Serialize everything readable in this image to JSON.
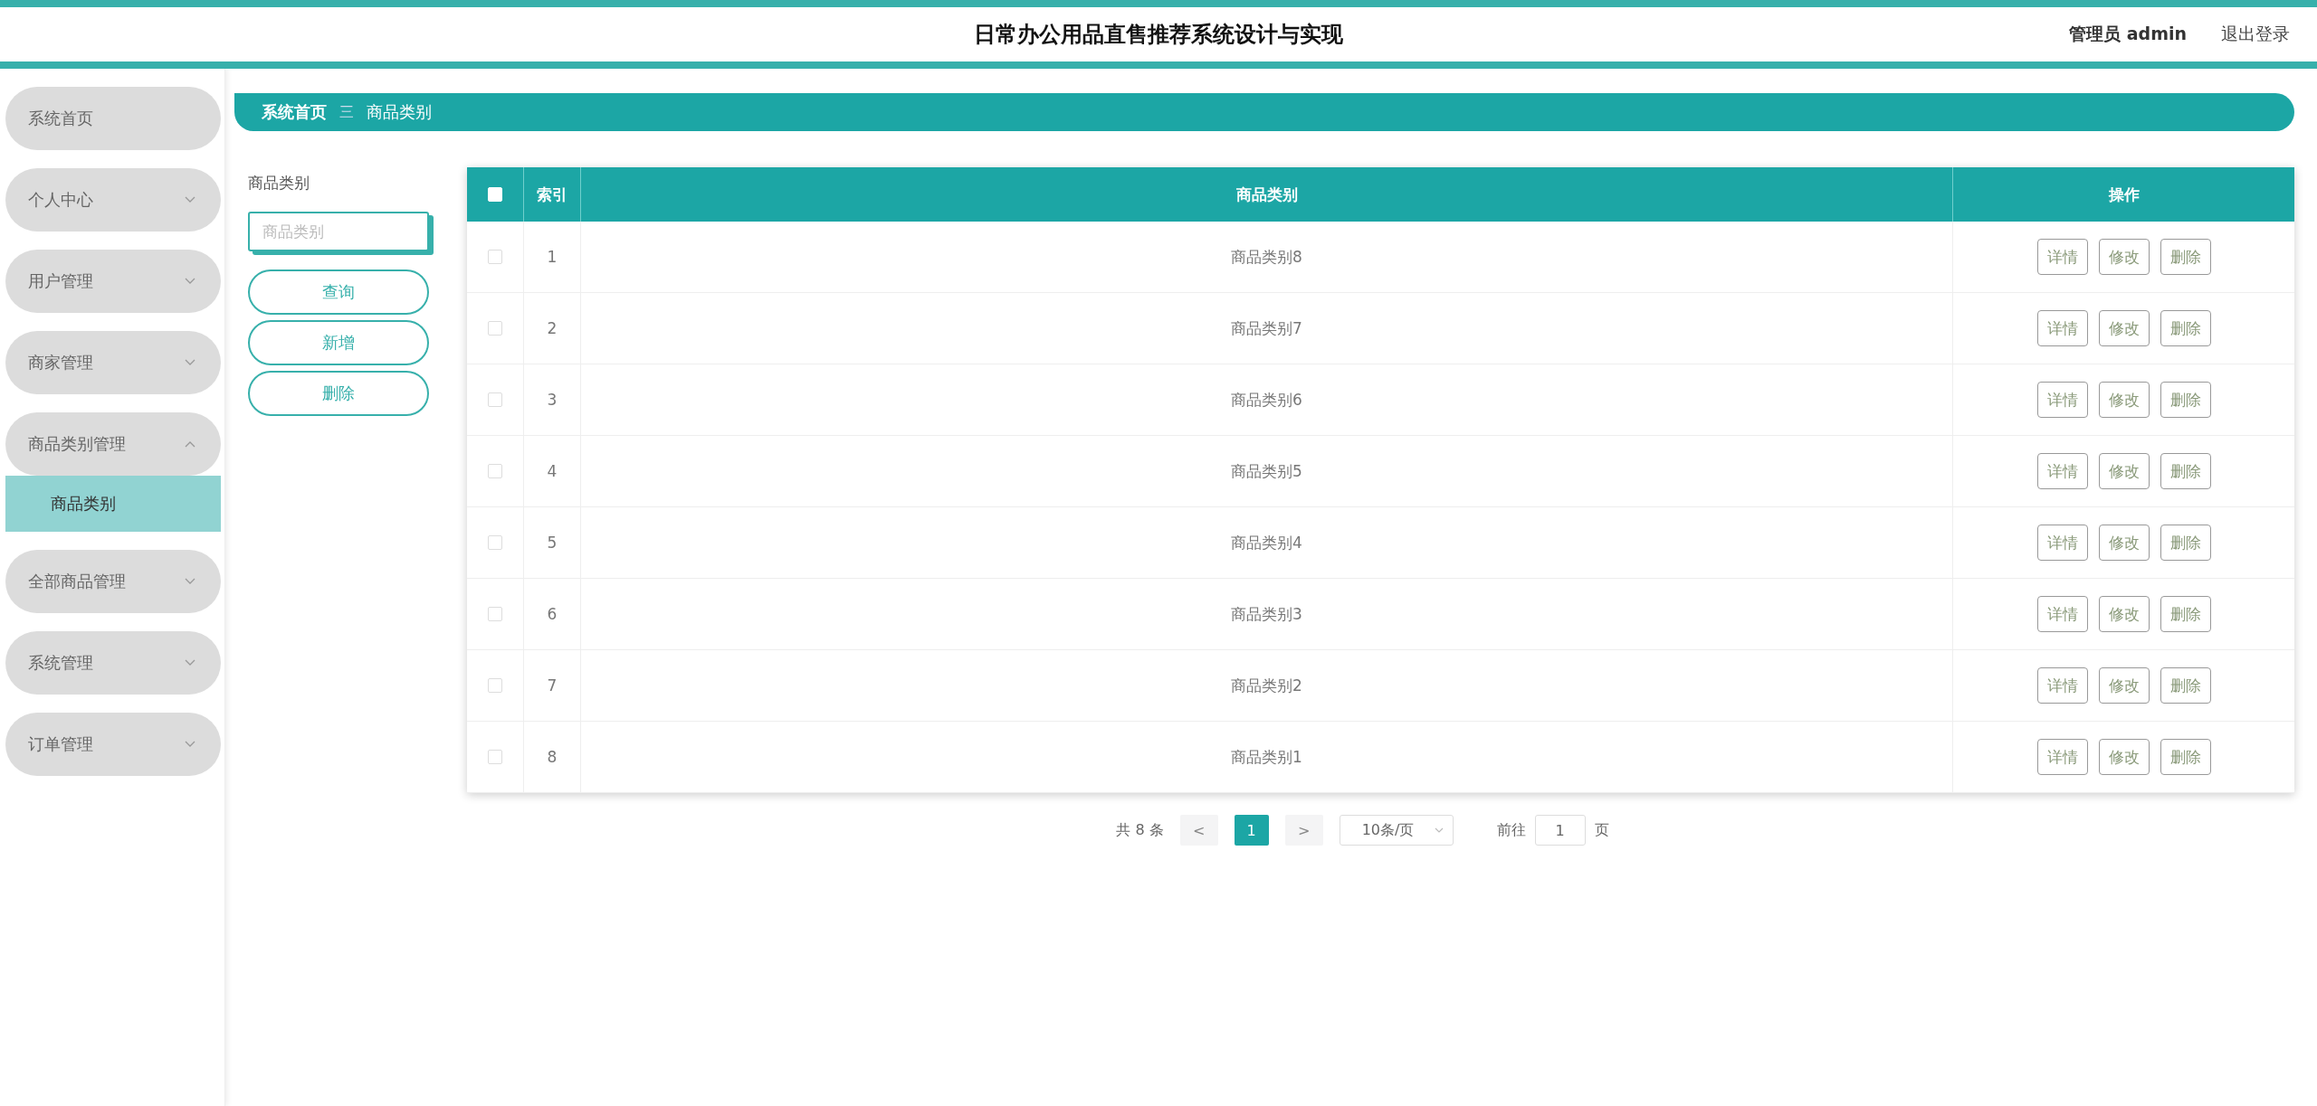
{
  "header": {
    "title": "日常办公用品直售推荐系统设计与实现",
    "user": "管理员 admin",
    "logout": "退出登录"
  },
  "sidebar": {
    "items": [
      {
        "label": "系统首页",
        "kind": "link",
        "selected": false
      },
      {
        "label": "个人中心",
        "kind": "menu",
        "expanded": false
      },
      {
        "label": "用户管理",
        "kind": "menu",
        "expanded": false
      },
      {
        "label": "商家管理",
        "kind": "menu",
        "expanded": false
      },
      {
        "label": "商品类别管理",
        "kind": "menu",
        "expanded": true,
        "children": [
          {
            "label": "商品类别",
            "selected": true
          }
        ]
      },
      {
        "label": "全部商品管理",
        "kind": "menu",
        "expanded": false
      },
      {
        "label": "系统管理",
        "kind": "menu",
        "expanded": false
      },
      {
        "label": "订单管理",
        "kind": "menu",
        "expanded": false
      }
    ]
  },
  "breadcrumb": {
    "items": [
      "系统首页",
      "商品类别"
    ],
    "separator": "三"
  },
  "search": {
    "label": "商品类别",
    "placeholder": "商品类别",
    "buttons": [
      "查询",
      "新增",
      "删除"
    ]
  },
  "table": {
    "header_checked": false,
    "columns": [
      "索引",
      "商品类别",
      "操作"
    ],
    "rows": [
      {
        "index": "1",
        "category": "商品类别8",
        "checked": false,
        "actions": [
          "详情",
          "修改",
          "删除"
        ]
      },
      {
        "index": "2",
        "category": "商品类别7",
        "checked": false,
        "actions": [
          "详情",
          "修改",
          "删除"
        ]
      },
      {
        "index": "3",
        "category": "商品类别6",
        "checked": false,
        "actions": [
          "详情",
          "修改",
          "删除"
        ]
      },
      {
        "index": "4",
        "category": "商品类别5",
        "checked": false,
        "actions": [
          "详情",
          "修改",
          "删除"
        ]
      },
      {
        "index": "5",
        "category": "商品类别4",
        "checked": false,
        "actions": [
          "详情",
          "修改",
          "删除"
        ]
      },
      {
        "index": "6",
        "category": "商品类别3",
        "checked": false,
        "actions": [
          "详情",
          "修改",
          "删除"
        ]
      },
      {
        "index": "7",
        "category": "商品类别2",
        "checked": false,
        "actions": [
          "详情",
          "修改",
          "删除"
        ]
      },
      {
        "index": "8",
        "category": "商品类别1",
        "checked": false,
        "actions": [
          "详情",
          "修改",
          "删除"
        ]
      }
    ]
  },
  "pagination": {
    "total": "共 8 条",
    "prev": "<",
    "pages": [
      {
        "label": "1",
        "selected": true
      }
    ],
    "next": ">",
    "page_size": "10条/页",
    "goto_label": "前往",
    "goto_value": "1",
    "goto_suffix": "页"
  }
}
